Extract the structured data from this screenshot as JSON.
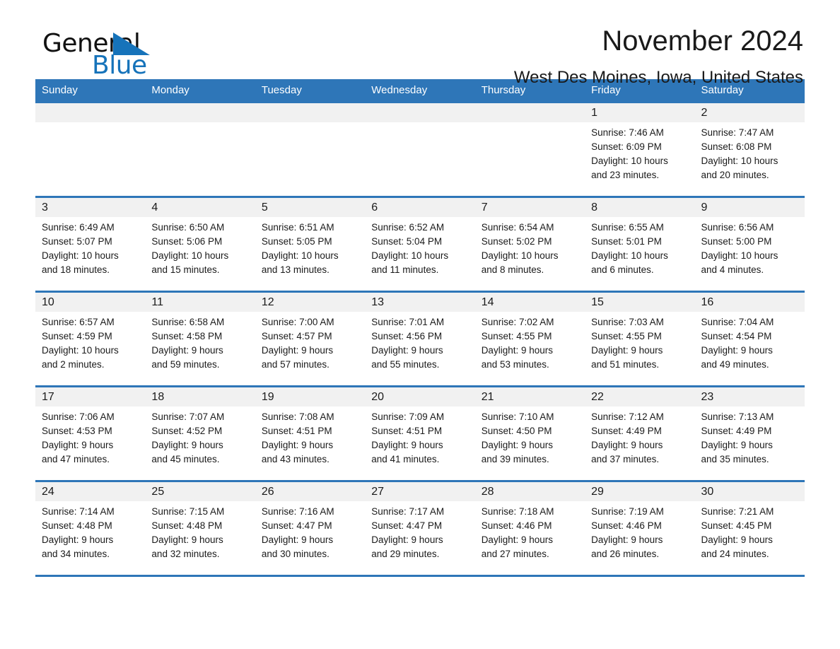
{
  "brand": {
    "name_part1": "General",
    "name_part2": "Blue",
    "triangle_color": "#1673BA"
  },
  "header": {
    "title": "November 2024",
    "subtitle": "West Des Moines, Iowa, United States"
  },
  "theme": {
    "accent": "#2E76B8",
    "header_text": "#FFFFFF",
    "daynum_band": "#F1F1F1",
    "cell_bg": "#FFFFFF",
    "text": "#1A1A1A"
  },
  "weekdays": [
    "Sunday",
    "Monday",
    "Tuesday",
    "Wednesday",
    "Thursday",
    "Friday",
    "Saturday"
  ],
  "labels": {
    "sunrise_prefix": "Sunrise: ",
    "sunset_prefix": "Sunset: ",
    "daylight_prefix": "Daylight: "
  },
  "weeks": [
    [
      {
        "day": "",
        "lines": []
      },
      {
        "day": "",
        "lines": []
      },
      {
        "day": "",
        "lines": []
      },
      {
        "day": "",
        "lines": []
      },
      {
        "day": "",
        "lines": []
      },
      {
        "day": "1",
        "lines": [
          "Sunrise: 7:46 AM",
          "Sunset: 6:09 PM",
          "Daylight: 10 hours",
          "and 23 minutes."
        ]
      },
      {
        "day": "2",
        "lines": [
          "Sunrise: 7:47 AM",
          "Sunset: 6:08 PM",
          "Daylight: 10 hours",
          "and 20 minutes."
        ]
      }
    ],
    [
      {
        "day": "3",
        "lines": [
          "Sunrise: 6:49 AM",
          "Sunset: 5:07 PM",
          "Daylight: 10 hours",
          "and 18 minutes."
        ]
      },
      {
        "day": "4",
        "lines": [
          "Sunrise: 6:50 AM",
          "Sunset: 5:06 PM",
          "Daylight: 10 hours",
          "and 15 minutes."
        ]
      },
      {
        "day": "5",
        "lines": [
          "Sunrise: 6:51 AM",
          "Sunset: 5:05 PM",
          "Daylight: 10 hours",
          "and 13 minutes."
        ]
      },
      {
        "day": "6",
        "lines": [
          "Sunrise: 6:52 AM",
          "Sunset: 5:04 PM",
          "Daylight: 10 hours",
          "and 11 minutes."
        ]
      },
      {
        "day": "7",
        "lines": [
          "Sunrise: 6:54 AM",
          "Sunset: 5:02 PM",
          "Daylight: 10 hours",
          "and 8 minutes."
        ]
      },
      {
        "day": "8",
        "lines": [
          "Sunrise: 6:55 AM",
          "Sunset: 5:01 PM",
          "Daylight: 10 hours",
          "and 6 minutes."
        ]
      },
      {
        "day": "9",
        "lines": [
          "Sunrise: 6:56 AM",
          "Sunset: 5:00 PM",
          "Daylight: 10 hours",
          "and 4 minutes."
        ]
      }
    ],
    [
      {
        "day": "10",
        "lines": [
          "Sunrise: 6:57 AM",
          "Sunset: 4:59 PM",
          "Daylight: 10 hours",
          "and 2 minutes."
        ]
      },
      {
        "day": "11",
        "lines": [
          "Sunrise: 6:58 AM",
          "Sunset: 4:58 PM",
          "Daylight: 9 hours",
          "and 59 minutes."
        ]
      },
      {
        "day": "12",
        "lines": [
          "Sunrise: 7:00 AM",
          "Sunset: 4:57 PM",
          "Daylight: 9 hours",
          "and 57 minutes."
        ]
      },
      {
        "day": "13",
        "lines": [
          "Sunrise: 7:01 AM",
          "Sunset: 4:56 PM",
          "Daylight: 9 hours",
          "and 55 minutes."
        ]
      },
      {
        "day": "14",
        "lines": [
          "Sunrise: 7:02 AM",
          "Sunset: 4:55 PM",
          "Daylight: 9 hours",
          "and 53 minutes."
        ]
      },
      {
        "day": "15",
        "lines": [
          "Sunrise: 7:03 AM",
          "Sunset: 4:55 PM",
          "Daylight: 9 hours",
          "and 51 minutes."
        ]
      },
      {
        "day": "16",
        "lines": [
          "Sunrise: 7:04 AM",
          "Sunset: 4:54 PM",
          "Daylight: 9 hours",
          "and 49 minutes."
        ]
      }
    ],
    [
      {
        "day": "17",
        "lines": [
          "Sunrise: 7:06 AM",
          "Sunset: 4:53 PM",
          "Daylight: 9 hours",
          "and 47 minutes."
        ]
      },
      {
        "day": "18",
        "lines": [
          "Sunrise: 7:07 AM",
          "Sunset: 4:52 PM",
          "Daylight: 9 hours",
          "and 45 minutes."
        ]
      },
      {
        "day": "19",
        "lines": [
          "Sunrise: 7:08 AM",
          "Sunset: 4:51 PM",
          "Daylight: 9 hours",
          "and 43 minutes."
        ]
      },
      {
        "day": "20",
        "lines": [
          "Sunrise: 7:09 AM",
          "Sunset: 4:51 PM",
          "Daylight: 9 hours",
          "and 41 minutes."
        ]
      },
      {
        "day": "21",
        "lines": [
          "Sunrise: 7:10 AM",
          "Sunset: 4:50 PM",
          "Daylight: 9 hours",
          "and 39 minutes."
        ]
      },
      {
        "day": "22",
        "lines": [
          "Sunrise: 7:12 AM",
          "Sunset: 4:49 PM",
          "Daylight: 9 hours",
          "and 37 minutes."
        ]
      },
      {
        "day": "23",
        "lines": [
          "Sunrise: 7:13 AM",
          "Sunset: 4:49 PM",
          "Daylight: 9 hours",
          "and 35 minutes."
        ]
      }
    ],
    [
      {
        "day": "24",
        "lines": [
          "Sunrise: 7:14 AM",
          "Sunset: 4:48 PM",
          "Daylight: 9 hours",
          "and 34 minutes."
        ]
      },
      {
        "day": "25",
        "lines": [
          "Sunrise: 7:15 AM",
          "Sunset: 4:48 PM",
          "Daylight: 9 hours",
          "and 32 minutes."
        ]
      },
      {
        "day": "26",
        "lines": [
          "Sunrise: 7:16 AM",
          "Sunset: 4:47 PM",
          "Daylight: 9 hours",
          "and 30 minutes."
        ]
      },
      {
        "day": "27",
        "lines": [
          "Sunrise: 7:17 AM",
          "Sunset: 4:47 PM",
          "Daylight: 9 hours",
          "and 29 minutes."
        ]
      },
      {
        "day": "28",
        "lines": [
          "Sunrise: 7:18 AM",
          "Sunset: 4:46 PM",
          "Daylight: 9 hours",
          "and 27 minutes."
        ]
      },
      {
        "day": "29",
        "lines": [
          "Sunrise: 7:19 AM",
          "Sunset: 4:46 PM",
          "Daylight: 9 hours",
          "and 26 minutes."
        ]
      },
      {
        "day": "30",
        "lines": [
          "Sunrise: 7:21 AM",
          "Sunset: 4:45 PM",
          "Daylight: 9 hours",
          "and 24 minutes."
        ]
      }
    ]
  ]
}
